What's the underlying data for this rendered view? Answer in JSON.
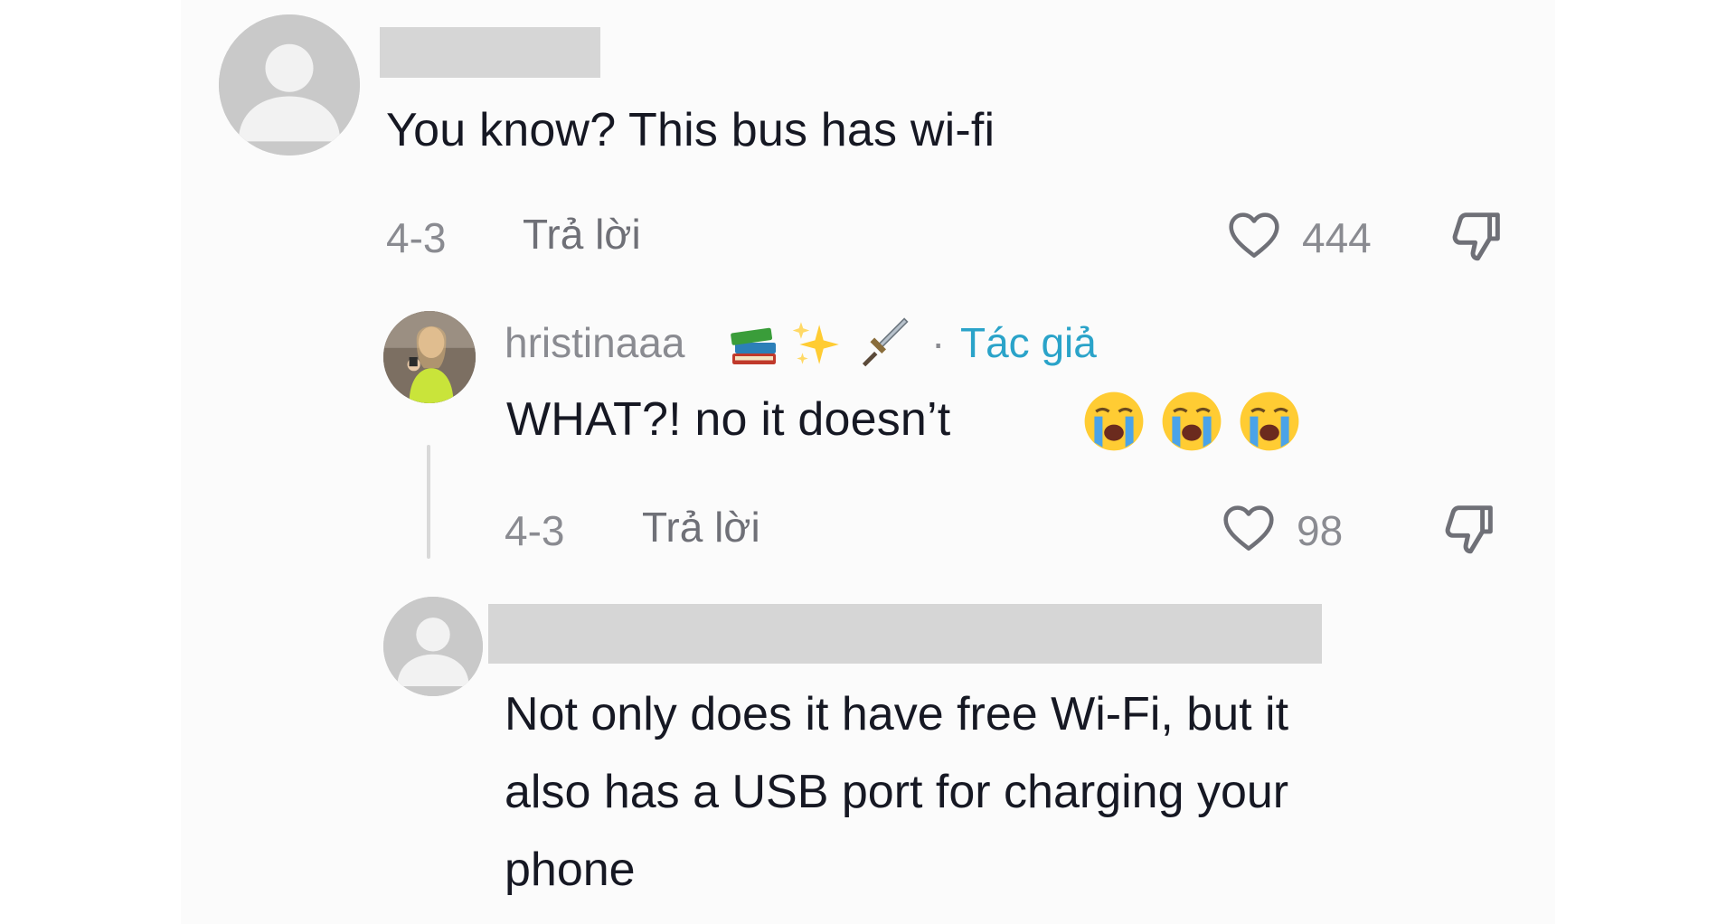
{
  "comment1": {
    "text": "You know? This bus has wi-fi",
    "date": "4-3",
    "reply_label": "Trả lời",
    "likes": "444"
  },
  "reply1": {
    "username": "hristinaaa",
    "author_separator": "·",
    "author_tag": "Tác giả",
    "text": "WHAT?! no it doesn’t",
    "date": "4-3",
    "reply_label": "Trả lời",
    "likes": "98",
    "username_emojis": [
      "books-icon",
      "sparkles-icon",
      "dagger-icon"
    ],
    "text_emojis": [
      "crying-face-icon",
      "crying-face-icon",
      "crying-face-icon"
    ]
  },
  "reply2": {
    "text_lines": [
      "Not only does it have free Wi-Fi, but it",
      "also has a USB port for charging your",
      "phone"
    ]
  },
  "colors": {
    "author_tag": "#2aa3c9",
    "meta_text": "#8a8b91",
    "body_text": "#161823",
    "redaction": "#d6d6d6"
  }
}
